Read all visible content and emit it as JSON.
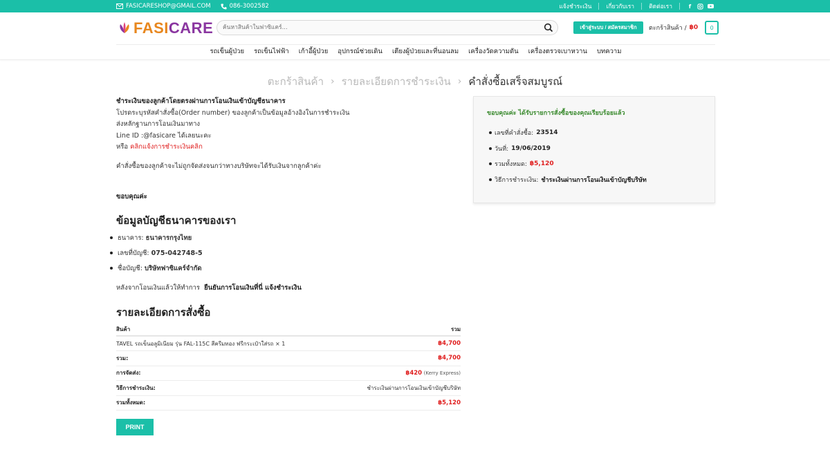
{
  "topbar": {
    "email": "FASICARESHOP@GMAIL.COM",
    "phone": "086-3002582",
    "links": [
      "แจ้งชำระเงิน",
      "เกี่ยวกับเรา",
      "ติดต่อเรา"
    ],
    "social_icons": [
      "facebook-icon",
      "instagram-icon",
      "youtube-icon"
    ],
    "accent_color": "#1bbfa8"
  },
  "header": {
    "logo_text_1": "FASI",
    "logo_text_2": "CARE",
    "search_placeholder": "ค้นหาสินค้าในฟาซิแคร์...",
    "login_label": "เข้าสู่ระบบ / สมัครสมาชิก",
    "cart_label": "ตะกร้าสินค้า /",
    "cart_price": "฿0",
    "cart_count": "0"
  },
  "nav": {
    "items": [
      "รถเข็นผู้ป่วย",
      "รถเข็นไฟฟ้า",
      "เก้าอี้ผู้ป่วย",
      "อุปกรณ์ช่วยเดิน",
      "เตียงผู้ป่วยและที่นอนลม",
      "เครื่องวัดความดัน",
      "เครื่องตรวจเบาหวาน",
      "บทความ"
    ]
  },
  "steps": {
    "step1": "ตะกร้าสินค้า",
    "step2": "รายละเอียดการชำระเงิน",
    "step3": "คำสั่งซื้อเสร็จสมบูรณ์"
  },
  "payment_info": {
    "heading": "ชำระเงินของลูกค้าโดยตรงผ่านการโอนเงินเข้าบัญชีธนาคาร",
    "line1": "โปรดระบุรหัสคำสั่งซื้อ(Order number) ของลูกค้าเป็นข้อมูลอ้างอิงในการชำระเงิน",
    "line2": "ส่งหลักฐานการโอนเงินมาทาง",
    "line3": "Line ID :@fasicare ได้เลยนะคะ",
    "line4_prefix": "หรือ",
    "line4_link": "คลิกแจ้งการชำระเงินคลิก",
    "note": "คำสั่งซื้อของลูกค้าจะไม่ถูกจัดส่งจนกว่าทางบริษัทจะได้รับเงินจากลูกค้าค่ะ",
    "thanks": "ขอบคุณค่ะ"
  },
  "bank": {
    "title": "ข้อมูลบัญชีธนาคารของเรา",
    "rows": [
      {
        "label": "ธนาคาร:",
        "value": "ธนาคารกรุงไทย"
      },
      {
        "label": "เลขที่บัญชี:",
        "value": "075-042748-5"
      },
      {
        "label": "ชื่อบัญชี:",
        "value": "บริษัทฟาซิแคร์จำกัด"
      }
    ],
    "after_prefix": "หลังจากโอนเงินแล้วให้ทำการ",
    "after_bold": "ยืนยันการโอนเงินที่นี่ แจ้งชำระเงิน"
  },
  "order": {
    "title": "รายละเอียดการสั่งซื้อ",
    "col_product": "สินค้า",
    "col_total": "รวม",
    "item_name": "TAVEL รถเข็นอลูมิเนียม รุ่น FAL-115C สีครีมทอง ฟรีกระเป๋าใส่รถ",
    "item_qty": "× 1",
    "item_price": "฿4,700",
    "subtotal_label": "รวม:",
    "subtotal_value": "฿4,700",
    "shipping_label": "การจัดส่ง:",
    "shipping_value": "฿420",
    "shipping_method": "(Kerry Express)",
    "payment_label": "วิธีการชำระเงิน:",
    "payment_value": "ชำระเงินผ่านการโอนเงินเข้าบัญชีบริษัท",
    "total_label": "รวมทั้งหมด:",
    "total_value": "฿5,120",
    "print_label": "PRINT"
  },
  "summary": {
    "thanks_text": "ขอบคุณค่ะ ได้รับรายการสั่งซื้อของคุณเรียบร้อยแล้ว",
    "order_no_label": "เลขที่คำสั่งซื้อ:",
    "order_no": "23514",
    "date_label": "วันที่:",
    "date": "19/06/2019",
    "total_label": "รวมทั้งหมด:",
    "total": "฿5,120",
    "method_label": "วิธีการชำระเงิน:",
    "method": "ชำระเงินผ่านการโอนเงินเข้าบัญชีบริษัท"
  }
}
